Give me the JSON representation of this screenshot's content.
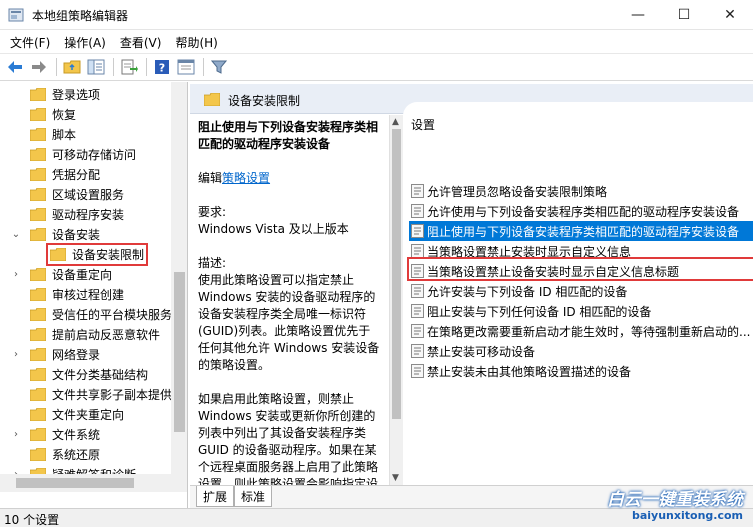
{
  "window": {
    "title": "本地组策略编辑器",
    "controls": [
      "—",
      "☐",
      "✕"
    ]
  },
  "menu": [
    "文件(F)",
    "操作(A)",
    "查看(V)",
    "帮助(H)"
  ],
  "tree": {
    "items": [
      {
        "label": "登录选项",
        "expand": ""
      },
      {
        "label": "恢复",
        "expand": ""
      },
      {
        "label": "脚本",
        "expand": ""
      },
      {
        "label": "可移动存储访问",
        "expand": ""
      },
      {
        "label": "凭据分配",
        "expand": ""
      },
      {
        "label": "区域设置服务",
        "expand": ""
      },
      {
        "label": "驱动程序安装",
        "expand": ""
      },
      {
        "label": "设备安装",
        "expand": "⌄"
      },
      {
        "label": "设备安装限制",
        "expand": ""
      },
      {
        "label": "设备重定向",
        "expand": "›"
      },
      {
        "label": "审核过程创建",
        "expand": ""
      },
      {
        "label": "受信任的平台模块服务",
        "expand": ""
      },
      {
        "label": "提前启动反恶意软件",
        "expand": ""
      },
      {
        "label": "网络登录",
        "expand": "›"
      },
      {
        "label": "文件分类基础结构",
        "expand": ""
      },
      {
        "label": "文件共享影子副本提供",
        "expand": ""
      },
      {
        "label": "文件夹重定向",
        "expand": ""
      },
      {
        "label": "文件系统",
        "expand": "›"
      },
      {
        "label": "系统还原",
        "expand": ""
      },
      {
        "label": "疑难解答和诊断",
        "expand": "›"
      }
    ]
  },
  "right": {
    "header": "设备安装限制",
    "description": {
      "title": "阻止使用与下列设备安装程序类相匹配的驱动程序安装设备",
      "edit_prefix": "编辑",
      "edit_link": "策略设置",
      "req_label": "要求:",
      "req_value": "Windows Vista 及以上版本",
      "desc_label": "描述:",
      "desc_p1": "使用此策略设置可以指定禁止 Windows 安装的设备驱动程序的设备安装程序类全局唯一标识符(GUID)列表。此策略设置优先于任何其他允许 Windows 安装设备的策略设置。",
      "desc_p2": "如果启用此策略设置，则禁止 Windows 安装或更新你所创建的列表中列出了其设备安装程序类 GUID 的设备驱动程序。如果在某个远程桌面服务器上启用了此策略设置，则此策略设置会影响指定设"
    },
    "settings_header": "设置",
    "settings": [
      "允许管理员忽略设备安装限制策略",
      "允许使用与下列设备安装程序类相匹配的驱动程序安装设备",
      "阻止使用与下列设备安装程序类相匹配的驱动程序安装设备",
      "当策略设置禁止安装时显示自定义信息",
      "当策略设置禁止设备安装时显示自定义信息标题",
      "允许安装与下列设备 ID 相匹配的设备",
      "阻止安装与下列任何设备 ID 相匹配的设备",
      "在策略更改需要重新启动才能生效时，等待强制重新启动的...",
      "禁止安装可移动设备",
      "禁止安装未由其他策略设置描述的设备"
    ],
    "tabs": [
      "扩展",
      "标准"
    ]
  },
  "status": "10 个设置",
  "watermark": {
    "brand": "白云一键重装系统",
    "url": "baiyunxitong.com"
  },
  "colors": {
    "selection": "#0078d7",
    "highlight_box": "#e03a3a",
    "folder": "#f3c64b",
    "link": "#0066cc"
  }
}
